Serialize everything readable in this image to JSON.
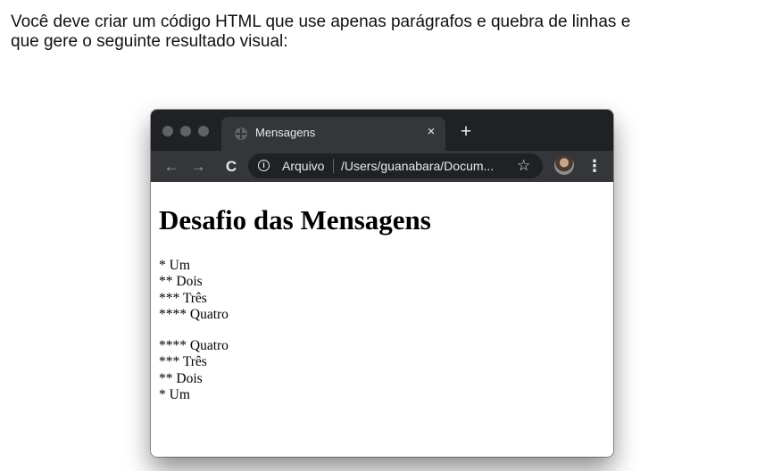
{
  "instructions": {
    "line1": "Você deve criar um código HTML que use apenas parágrafos e quebra de linhas e",
    "line2": "que gere o seguinte resultado visual:"
  },
  "browser": {
    "tab_title": "Mensagens",
    "tab_close": "×",
    "new_tab": "+",
    "back": "←",
    "forward": "→",
    "reload": "C",
    "info_icon": "i",
    "security_label": "Arquivo",
    "url": "/Users/guanabara/Docum...",
    "star": "☆",
    "menu": "⋮"
  },
  "page": {
    "heading": "Desafio das Mensagens",
    "paragraph1": [
      "* Um",
      "** Dois",
      "*** Três",
      "**** Quatro"
    ],
    "paragraph2": [
      "**** Quatro",
      "*** Três",
      "** Dois",
      "* Um"
    ]
  }
}
